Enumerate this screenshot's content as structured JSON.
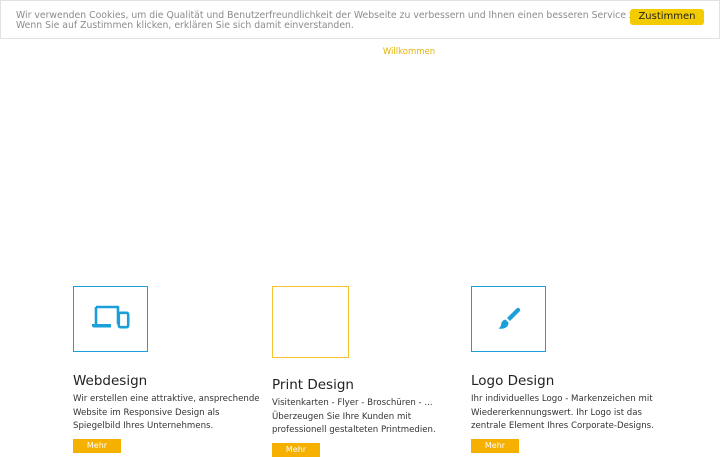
{
  "cookie_banner": {
    "line1": "Wir verwenden Cookies, um die Qualität und Benutzerfreundlichkeit der Webseite zu verbessern und Ihnen einen besseren Service zu bieten.",
    "line2": "Wenn Sie auf Zustimmen klicken, erklären Sie sich damit einverstanden.",
    "accept_label": "Zustimmen"
  },
  "nav": {
    "welcome_label": "Willkommen"
  },
  "services": [
    {
      "title": "Webdesign",
      "desc": [
        "Wir erstellen eine attraktive, ansprechende",
        "Website im Responsive Design als",
        "Spiegelbild Ihres Unternehmens."
      ],
      "more_label": "Mehr",
      "icon": "devices-icon",
      "border_color": "#1a9fd9"
    },
    {
      "title": "Print Design",
      "desc": [
        "Visitenkarten - Flyer - Broschüren - ...",
        "Überzeugen Sie Ihre Kunden mit",
        "professionell gestalteten Printmedien."
      ],
      "more_label": "Mehr",
      "icon": "",
      "border_color": "#f2c230"
    },
    {
      "title": "Logo Design",
      "desc": [
        "Ihr individuelles Logo - Markenzeichen mit",
        "Wiedererkennungswert. Ihr Logo ist das",
        "zentrale Element Ihres Corporate-Designs."
      ],
      "more_label": "Mehr",
      "icon": "paintbrush-icon",
      "border_color": "#1a9fd9"
    }
  ]
}
